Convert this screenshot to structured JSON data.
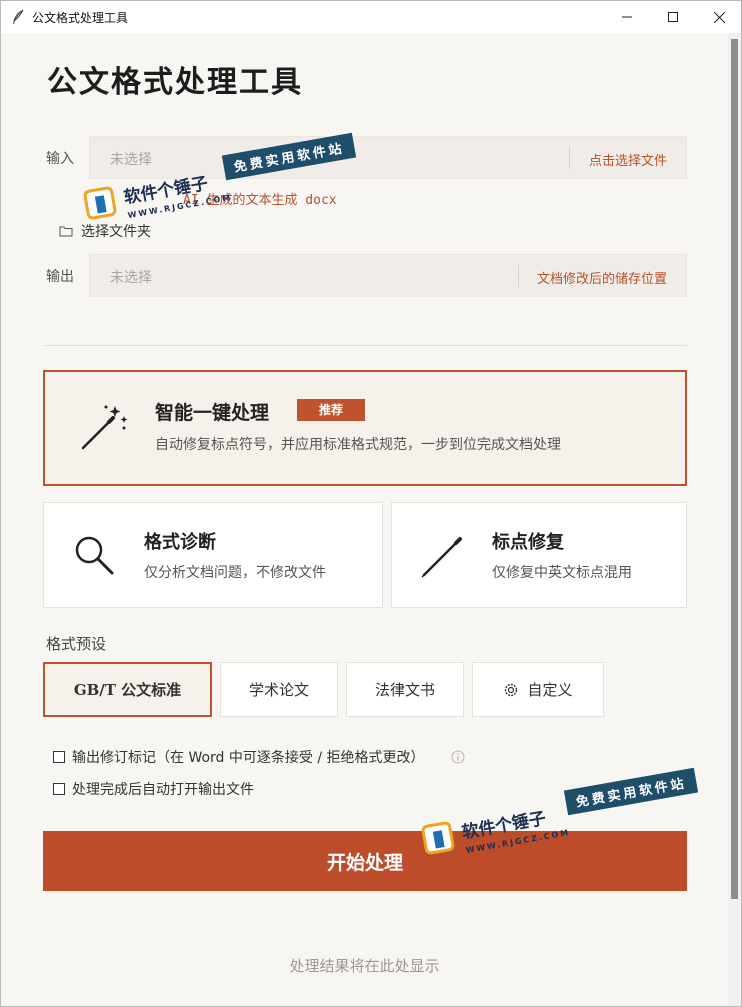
{
  "window": {
    "title": "公文格式处理工具",
    "app_icon": "feather-icon",
    "controls": [
      "minimize-icon",
      "maximize-icon",
      "close-icon"
    ]
  },
  "header": {
    "title": "公文格式处理工具"
  },
  "input": {
    "label": "输入",
    "placeholder": "未选择",
    "action": "点击选择文件",
    "hint": "AI 生成的文本生成 docx",
    "folder_label": "选择文件夹",
    "folder_icon": "folder-icon"
  },
  "output": {
    "label": "输出",
    "placeholder": "未选择",
    "action": "文档修改后的储存位置"
  },
  "modes": {
    "primary": {
      "name": "智能一键处理",
      "badge": "推荐",
      "desc": "自动修复标点符号，并应用标准格式规范，一步到位完成文档处理",
      "icon": "magic-wand-icon"
    },
    "diagnose": {
      "name": "格式诊断",
      "desc": "仅分析文档问题，不修改文件",
      "icon": "magnifier-icon"
    },
    "punctuation": {
      "name": "标点修复",
      "desc": "仅修复中英文标点混用",
      "icon": "pen-icon"
    }
  },
  "presets": {
    "label": "格式预设",
    "items": [
      "GB/T 公文标准",
      "学术论文",
      "法律文书",
      "自定义"
    ],
    "selected": "GB/T 公文标准",
    "custom_icon": "gear-icon"
  },
  "options": {
    "track_changes": "输出修订标记（在 Word 中可逐条接受 / 拒绝格式更改）",
    "auto_open": "处理完成后自动打开输出文件",
    "info_icon": "info-icon"
  },
  "start_button": "开始处理",
  "result": "处理结果将在此处显示",
  "watermark": {
    "logo": "软件个锤子",
    "slogan": "免费实用软件站",
    "url": "WWW.RJGCZ.COM"
  },
  "colors": {
    "accent": "#bd4d2a",
    "background": "#f8f6f3",
    "field_bg": "#f0ece7",
    "watermark_blue": "#1f4e6b"
  }
}
